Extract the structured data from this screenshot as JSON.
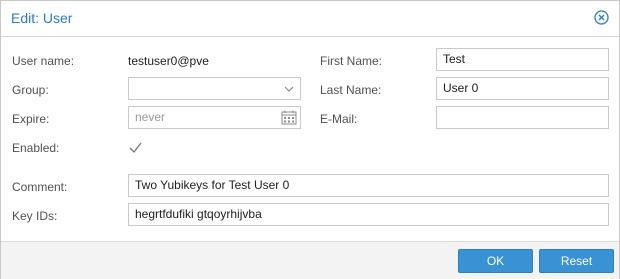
{
  "dialog": {
    "title": "Edit: User"
  },
  "form": {
    "username_label": "User name:",
    "username_value": "testuser0@pve",
    "group_label": "Group:",
    "group_value": "",
    "expire_label": "Expire:",
    "expire_placeholder": "never",
    "enabled_label": "Enabled:",
    "enabled_checked": true,
    "firstname_label": "First Name:",
    "firstname_value": "Test",
    "lastname_label": "Last Name:",
    "lastname_value": "User 0",
    "email_label": "E-Mail:",
    "email_value": "",
    "comment_label": "Comment:",
    "comment_value": "Two Yubikeys for Test User 0",
    "keyids_label": "Key IDs:",
    "keyids_value": "hegrtfdufiki gtqoyrhijvba"
  },
  "footer": {
    "ok_label": "OK",
    "reset_label": "Reset"
  },
  "colors": {
    "accent": "#2d7bbf",
    "button": "#3892d3",
    "footer_bg": "#f3f3f3"
  },
  "icons": {
    "close": "close-circle-icon",
    "dropdown": "chevron-down-icon",
    "calendar": "calendar-icon",
    "check": "checkmark-icon"
  }
}
